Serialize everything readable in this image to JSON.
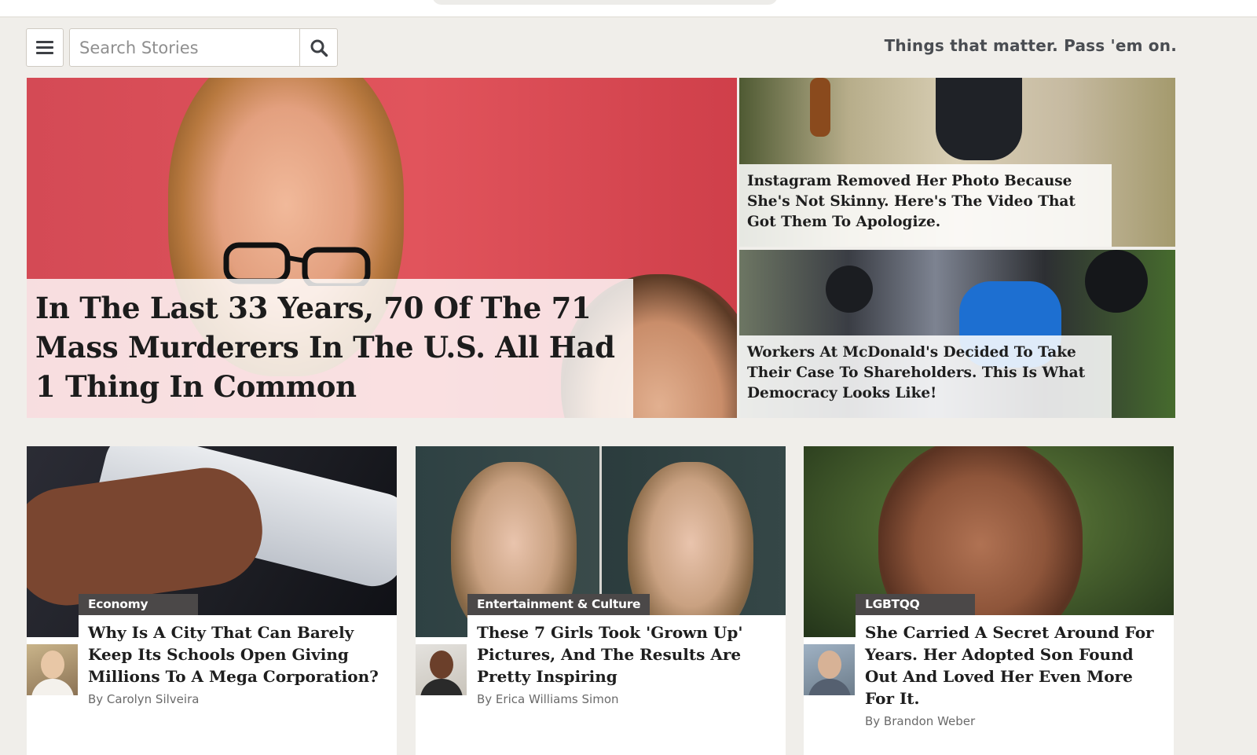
{
  "toolbar": {
    "search_placeholder": "Search Stories",
    "tagline": "Things that matter. Pass 'em on."
  },
  "hero": {
    "title": "In The Last 33 Years, 70 Of The 71 Mass Murderers In The U.S. All Had 1 Thing In Common"
  },
  "side_stories": [
    {
      "title": "Instagram Removed Her Photo Because She's Not Skinny. Here's The Video That Got Them To Apologize."
    },
    {
      "title": "Workers At McDonald's Decided To Take Their Case To Shareholders. This Is What Democracy Looks Like!"
    }
  ],
  "cards": [
    {
      "category": "Economy",
      "title": "Why Is A City That Can Barely Keep Its Schools Open Giving Millions To A Mega Corporation?",
      "byline": "By Carolyn Silveira"
    },
    {
      "category": "Entertainment & Culture",
      "title": "These 7 Girls Took 'Grown Up' Pictures, And The Results Are Pretty Inspiring",
      "byline": "By Erica Williams Simon"
    },
    {
      "category": "LGBTQQ",
      "title": "She Carried A Secret Around For Years. Her Adopted Son Found Out And Loved Her Even More For It.",
      "byline": "By Brandon Weber"
    }
  ],
  "colors": {
    "page_bg": "#f0eeea",
    "category_bg": "#4b4848",
    "hero_bg": "#d44a55"
  },
  "icons": [
    "menu-icon",
    "search-icon"
  ]
}
